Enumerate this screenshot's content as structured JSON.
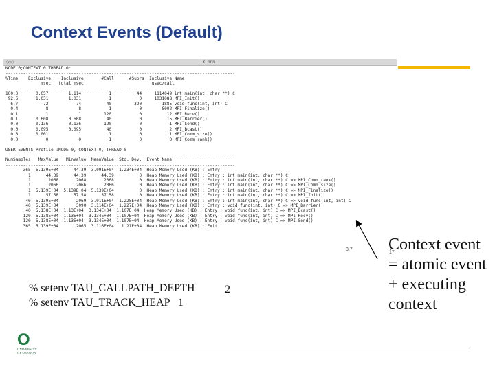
{
  "slide": {
    "title": "Context Events (Default)"
  },
  "terminal": {
    "window_controls": "○○○",
    "window_title": "X nnm",
    "node_line": "NODE 0;CONTEXT 0;THREAD 0:",
    "header1": "%Time    Exclusive    Inclusive       #Call      #Subrs  Inclusive Name",
    "header2": "              msec   total msec                           usec/call",
    "rows": [
      "100.0       0.057        1,114           1          44     1114049 int main(int, char **) C",
      " 92.6       1.031        1.031           1           0     1031088 MPI_Init()",
      "  6.7          72           74          40         320        1885 void func(int, int) C",
      "  0.4           8            8           1           0        8002 MPI_Finalize()",
      "  0.1           1            1         120           0          12 MPI_Recv()",
      "  0.1       0.608        0.608          40           0          15 MPI_Barrier()",
      "  0.0       0.136        0.136         120           0           1 MPI_Send()",
      "  0.0       0.095        0.095          40           0           2 MPI_Bcast()",
      "  0.0       0.001            1           1           0           1 MPI_Comm_size()",
      "  0.0           0            0           1           0           0 MPI_Comm_rank()"
    ],
    "user_events_title": "USER EVENTS Profile :NODE 0, CONTEXT 0, THREAD 0",
    "events_header": "NumSamples   MaxValue   MinValue  MeanValue  Std. Dev.  Event Name",
    "event_rows": [
      "       365  5.139E+04      44.39  3.091E+04  1.234E+04  Heap Memory Used (KB) : Entry",
      "         1      44.39      44.39      44.39          0  Heap Memory Used (KB) : Entry : int main(int, char **) C",
      "         1       2068       2068       2068          0  Heap Memory Used (KB) : Entry : int main(int, char **) C => MPI_Comm_rank()",
      "         1       2066       2066       2066          0  Heap Memory Used (KB) : Entry : int main(int, char **) C => MPI_Comm_size()",
      "         1  5.139E+04  5.139E+04  5.139E+04          0  Heap Memory Used (KB) : Entry : int main(int, char **) C => MPI_Finalize()",
      "         1      57.58      57.58      57.58          0  Heap Memory Used (KB) : Entry : int main(int, char **) C => MPI_Init()",
      "        40  5.139E+04       2069  3.011E+04  1.228E+04  Heap Memory Used (KB) : Entry : int main(int, char **) C => void func(int, int) C",
      "        40  5.139E+04       3090  3.114E+04  1.227E+04  Heap Memory Used (KB) : Entry : void func(int, int) C => MPI_Barrier()",
      "        40  5.138E+04  1.13E+04  3.134E+04  1.107E+04  Heap Memory Used (KB) : Entry : void func(int, int) C => MPI_Bcast()",
      "       120  5.138E+04  1.13E+04  3.134E+04  1.107E+04  Heap Memory Used (KB) : Entry : void func(int, int) C => MPI_Recv()",
      "       120  5.138E+04  1.13E+04  3.134E+04  1.107E+04  Heap Memory Used (KB) : Entry : void func(int, int) C => MPI_Send()",
      "       365  5.139E+04       2065  3.116E+04   1.21E+04  Heap Memory Used (KB) : Exit"
    ],
    "corner_number": "3.7",
    "tiny_number": "17,"
  },
  "env": {
    "line1": "% setenv TAU_CALLPATH_DEPTH",
    "line1_value": "2",
    "line2": "% setenv TAU_TRACK_HEAP   1"
  },
  "callout": {
    "line1": "Context event",
    "line2": "= atomic event",
    "line3": "+ executing",
    "line4": "context"
  },
  "logo": {
    "mark": "O",
    "line1": "UNIVERSITY",
    "line2": "OF OREGON"
  },
  "colors": {
    "title": "#1f3f8f",
    "accent_bar": "#f2b800",
    "logo_green": "#1b7a3d"
  }
}
